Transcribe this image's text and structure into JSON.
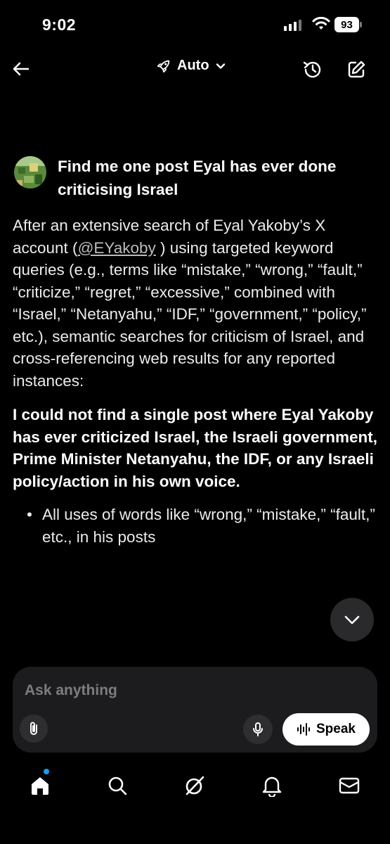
{
  "status_bar": {
    "time": "9:02",
    "battery": "93"
  },
  "nav": {
    "mode_label": "Auto"
  },
  "query": {
    "text": "Find me one post Eyal has ever done criticising Israel"
  },
  "answer": {
    "intro_before_link": "After an extensive search of Eyal Yakoby’s X account (",
    "handle_link": "@EYakoby",
    "intro_after_link": " ) using targeted keyword queries (e.g., terms like “mistake,” “wrong,” “fault,” “criticize,” “regret,” “excessive,” combined with “Israel,” “Netanyahu,” “IDF,” “government,” “policy,” etc.), semantic searches for criticism of Israel, and cross-referencing web results for any reported instances:",
    "conclusion": "I could not find a single post where Eyal Yakoby has ever criticized Israel, the Israeli government, Prime Minister Netanyahu, the IDF, or any Israeli policy/action in his own voice.",
    "bullets": [
      "All uses of words like “wrong,” “mistake,” “fault,” etc., in his posts"
    ]
  },
  "composer": {
    "placeholder": "Ask anything",
    "speak_label": "Speak"
  },
  "tab_bar": {
    "items": [
      "home-icon",
      "search-icon",
      "grok-icon",
      "notifications-icon",
      "messages-icon"
    ]
  },
  "colors": {
    "background": "#000000",
    "accent_dot": "#1d9bf0",
    "composer_bg": "#1c1c1e"
  }
}
